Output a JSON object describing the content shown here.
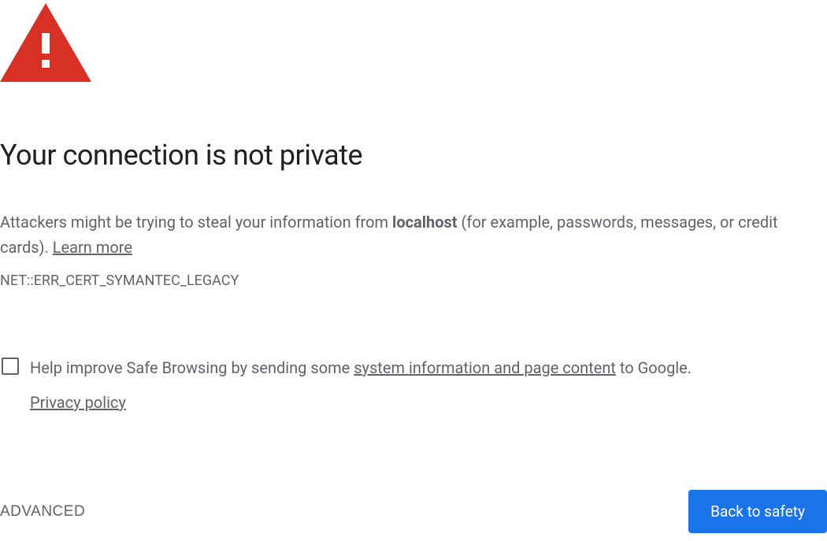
{
  "icon": {
    "fill": "#d93025",
    "exclaim_fill": "#ffffff"
  },
  "heading": "Your connection is not private",
  "description": {
    "prefix": "Attackers might be trying to steal your information from ",
    "hostname": "localhost",
    "suffix": " (for example, passwords, messages, or credit cards). ",
    "learn_more": "Learn more"
  },
  "error_code": "NET::ERR_CERT_SYMANTEC_LEGACY",
  "opt_in": {
    "prefix": "Help improve Safe Browsing by sending some ",
    "link_text": "system information and page content",
    "suffix": " to Google.",
    "privacy_policy": "Privacy policy"
  },
  "buttons": {
    "advanced": "ADVANCED",
    "back_to_safety": "Back to safety"
  }
}
